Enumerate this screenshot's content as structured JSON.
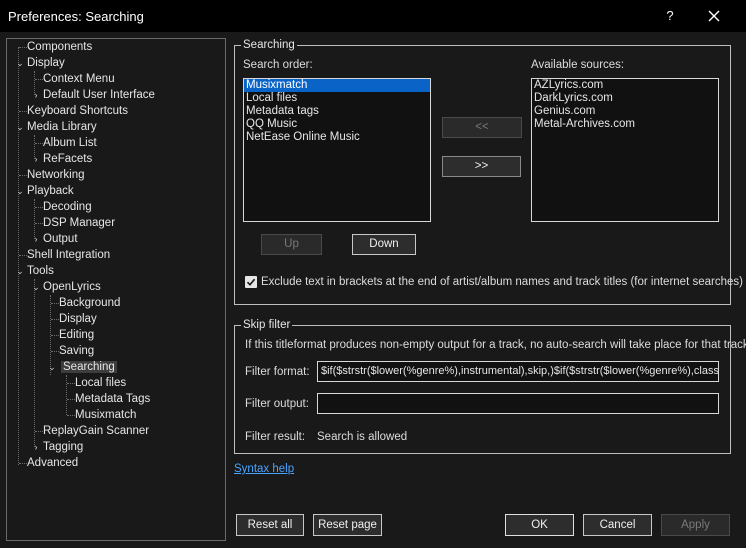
{
  "window": {
    "title": "Preferences: Searching",
    "help_label": "?"
  },
  "tree": {
    "items": [
      {
        "label": "Components"
      },
      {
        "label": "Display"
      },
      {
        "label": "Context Menu"
      },
      {
        "label": "Default User Interface"
      },
      {
        "label": "Keyboard Shortcuts"
      },
      {
        "label": "Media Library"
      },
      {
        "label": "Album List"
      },
      {
        "label": "ReFacets"
      },
      {
        "label": "Networking"
      },
      {
        "label": "Playback"
      },
      {
        "label": "Decoding"
      },
      {
        "label": "DSP Manager"
      },
      {
        "label": "Output"
      },
      {
        "label": "Shell Integration"
      },
      {
        "label": "Tools"
      },
      {
        "label": "OpenLyrics"
      },
      {
        "label": "Background"
      },
      {
        "label": "Display"
      },
      {
        "label": "Editing"
      },
      {
        "label": "Saving"
      },
      {
        "label": "Searching"
      },
      {
        "label": "Local files"
      },
      {
        "label": "Metadata Tags"
      },
      {
        "label": "Musixmatch"
      },
      {
        "label": "ReplayGain Scanner"
      },
      {
        "label": "Tagging"
      },
      {
        "label": "Advanced"
      }
    ]
  },
  "searching": {
    "group_label": "Searching",
    "order_label": "Search order:",
    "available_label": "Available sources:",
    "order_items": [
      "Musixmatch",
      "Local files",
      "Metadata tags",
      "QQ Music",
      "NetEase Online Music"
    ],
    "selected_order_item": "Musixmatch",
    "available_items": [
      "AZLyrics.com",
      "DarkLyrics.com",
      "Genius.com",
      "Metal-Archives.com"
    ],
    "move_left_label": "<<",
    "move_right_label": ">>",
    "up_label": "Up",
    "down_label": "Down",
    "exclude_brackets_label": "Exclude text in brackets at the end of artist/album names and track titles (for internet searches)",
    "exclude_brackets_checked": true
  },
  "skip_filter": {
    "group_label": "Skip filter",
    "description": "If this titleformat produces non-empty output for a track, no auto-search will take place for that track",
    "format_label": "Filter format:",
    "format_value": "$if($strstr($lower(%genre%),instrumental),skip,)$if($strstr($lower(%genre%),classical),skip,)",
    "output_label": "Filter output:",
    "output_value": "",
    "result_label": "Filter result:",
    "result_value": "Search is allowed"
  },
  "syntax_help_label": "Syntax help",
  "footer": {
    "reset_all_label": "Reset all",
    "reset_page_label": "Reset page",
    "ok_label": "OK",
    "cancel_label": "Cancel",
    "apply_label": "Apply"
  },
  "colors": {
    "background": "#191919",
    "titlebar": "#000000",
    "selection": "#0a64c8",
    "link": "#4aa3ff"
  }
}
